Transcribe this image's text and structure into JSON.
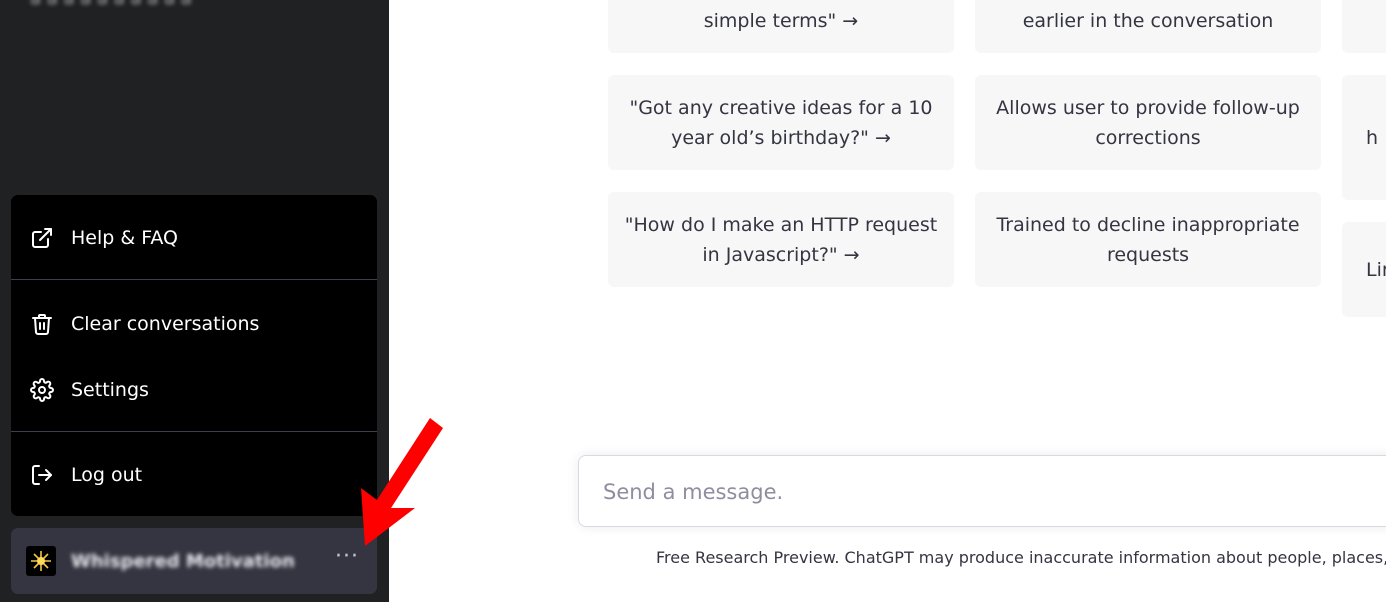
{
  "sidebar": {
    "top_text": "a a a a a a a a a a",
    "menu": {
      "help": {
        "label": "Help & FAQ",
        "icon": "external-link-icon"
      },
      "clear": {
        "label": "Clear conversations",
        "icon": "trash-icon"
      },
      "settings": {
        "label": "Settings",
        "icon": "gear-icon"
      },
      "logout": {
        "label": "Log out",
        "icon": "logout-icon"
      }
    },
    "user": {
      "name": "Whispered Motivation",
      "more": "···"
    }
  },
  "main": {
    "cards": {
      "c1_top": "simple terms\" →",
      "c2_top": "earlier in the conversation",
      "c1_mid": "\"Got any creative ideas for a 10 year old’s birthday?\" →",
      "c2_mid": "Allows user to provide follow-up corrections",
      "c3_mid": "h",
      "c1_bot": "\"How do I make an HTTP request in Javascript?\" →",
      "c2_bot": "Trained to decline inappropriate requests",
      "c3_bot": "Lir"
    },
    "input": {
      "placeholder": "Send a message."
    },
    "footer": "Free Research Preview. ChatGPT may produce inaccurate information about people, places,"
  },
  "colors": {
    "sidebar_bg": "#202123",
    "menu_bg": "#000000",
    "card_bg": "#f7f7f8",
    "arrow": "#ff0000"
  }
}
